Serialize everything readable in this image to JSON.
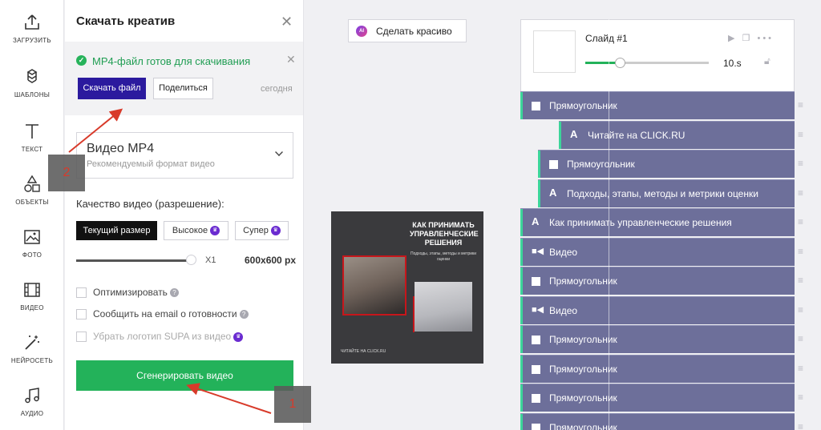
{
  "toolbar": {
    "items": [
      {
        "label": "ЗАГРУЗИТЬ",
        "icon": "upload-icon"
      },
      {
        "label": "ШАБЛОНЫ",
        "icon": "templates-icon"
      },
      {
        "label": "ТЕКСТ",
        "icon": "text-icon"
      },
      {
        "label": "ОБЪЕКТЫ",
        "icon": "shapes-icon"
      },
      {
        "label": "ФОТО",
        "icon": "photo-icon"
      },
      {
        "label": "ВИДЕО",
        "icon": "video-icon"
      },
      {
        "label": "НЕЙРОСЕТЬ",
        "icon": "magic-wand-icon"
      },
      {
        "label": "АУДИО",
        "icon": "music-icon"
      }
    ]
  },
  "panel": {
    "title": "Скачать креатив",
    "ready": {
      "message": "MP4-файл готов для скачивания",
      "download_label": "Скачать файл",
      "share_label": "Поделиться",
      "date": "сегодня"
    },
    "format": {
      "name": "Видео MP4",
      "description": "Рекомендуемый формат видео"
    },
    "quality": {
      "label": "Качество видео (разрешение):",
      "options": [
        "Текущий размер",
        "Высокое",
        "Супер"
      ],
      "selected": "Текущий размер",
      "scale": "X1",
      "size": "600x600 px"
    },
    "options": [
      {
        "label": "Оптимизировать",
        "checked": false
      },
      {
        "label": "Сообщить на email о готовности",
        "checked": false
      },
      {
        "label": "Убрать логотип SUPA из видео",
        "checked": false
      }
    ],
    "generate_label": "Сгенерировать видео"
  },
  "canvas": {
    "beautify_label": "Сделать красиво",
    "ai_badge": "AI",
    "creative": {
      "title": "КАК ПРИНИМАТЬ УПРАВЛЕНЧЕСКИЕ РЕШЕНИЯ",
      "subtitle": "Подходы, этапы, методы и метрики оценки",
      "footer": "ЧИТАЙТЕ НА CLICK.RU"
    }
  },
  "layers": {
    "slide": {
      "title": "Слайд #1",
      "duration": "10.s",
      "progress": 0.28
    },
    "items": [
      {
        "type": "rect",
        "label": "Прямоугольник"
      },
      {
        "type": "text",
        "label": "Читайте на CLICK.RU"
      },
      {
        "type": "rect",
        "label": "Прямоугольник"
      },
      {
        "type": "text",
        "label": "Подходы, этапы, методы и метрики оценки"
      },
      {
        "type": "text",
        "label": "Как принимать управленческие решения"
      },
      {
        "type": "video",
        "label": "Видео"
      },
      {
        "type": "rect",
        "label": "Прямоугольник"
      },
      {
        "type": "video",
        "label": "Видео"
      },
      {
        "type": "rect",
        "label": "Прямоугольник"
      },
      {
        "type": "rect",
        "label": "Прямоугольник"
      },
      {
        "type": "rect",
        "label": "Прямоугольник"
      },
      {
        "type": "rect",
        "label": "Прямоугольник"
      }
    ]
  },
  "annotations": [
    {
      "number": "1"
    },
    {
      "number": "2"
    }
  ],
  "colors": {
    "accent_green": "#23b25a",
    "download_button": "#2b1a9e",
    "layer_bg": "#6d6f9a",
    "layer_accent": "#3cd59a",
    "annotation_arrow": "#d83a2a"
  }
}
